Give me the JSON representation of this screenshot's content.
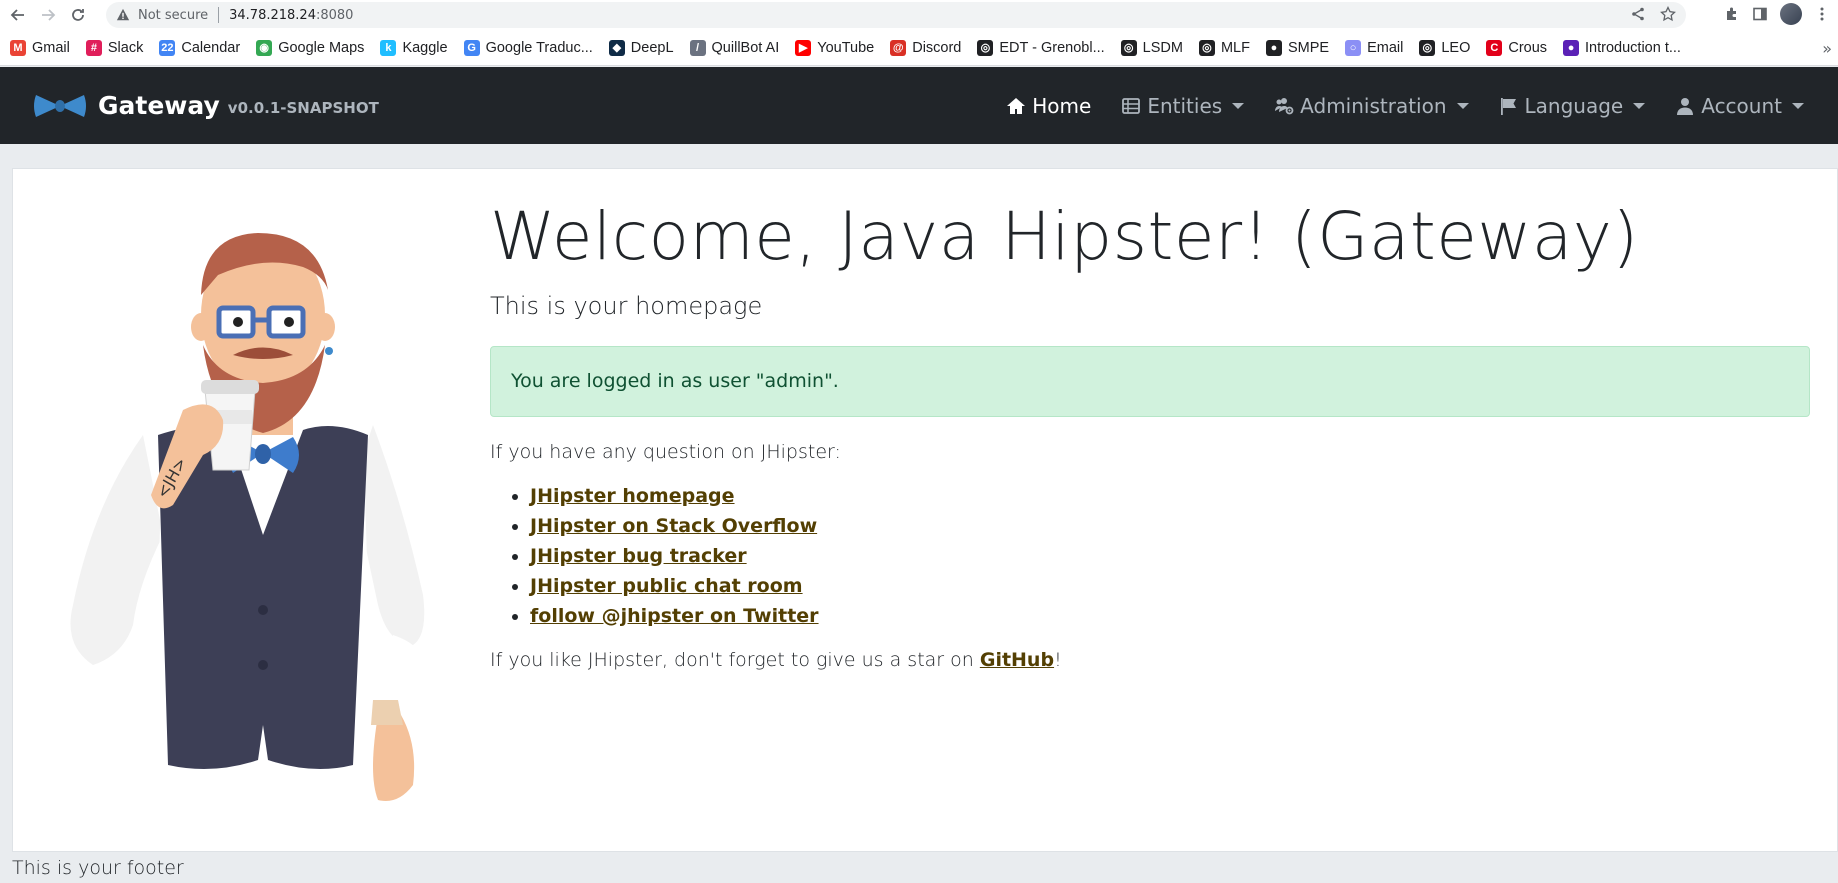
{
  "browser": {
    "security_label": "Not secure",
    "url_host": "34.78.218.24",
    "url_port": ":8080"
  },
  "bookmarks": [
    {
      "label": "Gmail",
      "icon": "gmail-icon",
      "color": "#ea4335",
      "glyph": "M"
    },
    {
      "label": "Slack",
      "icon": "slack-icon",
      "color": "#e01e5a",
      "glyph": "#"
    },
    {
      "label": "Calendar",
      "icon": "calendar-icon",
      "color": "#4285f4",
      "glyph": "22"
    },
    {
      "label": "Google Maps",
      "icon": "maps-icon",
      "color": "#34a853",
      "glyph": "◉"
    },
    {
      "label": "Kaggle",
      "icon": "kaggle-icon",
      "color": "#20beff",
      "glyph": "k"
    },
    {
      "label": "Google Traduc...",
      "icon": "translate-icon",
      "color": "#4285f4",
      "glyph": "G"
    },
    {
      "label": "DeepL",
      "icon": "deepl-icon",
      "color": "#0f2b46",
      "glyph": "◆"
    },
    {
      "label": "QuillBot AI",
      "icon": "quillbot-icon",
      "color": "#6b7280",
      "glyph": "/"
    },
    {
      "label": "YouTube",
      "icon": "youtube-icon",
      "color": "#ff0000",
      "glyph": "▶"
    },
    {
      "label": "Discord",
      "icon": "discord-icon",
      "color": "#d93025",
      "glyph": "@"
    },
    {
      "label": "EDT - Grenobl...",
      "icon": "globe-icon",
      "color": "#202124",
      "glyph": "◎"
    },
    {
      "label": "LSDM",
      "icon": "globe-icon",
      "color": "#202124",
      "glyph": "◎"
    },
    {
      "label": "MLF",
      "icon": "globe-icon",
      "color": "#202124",
      "glyph": "◎"
    },
    {
      "label": "SMPE",
      "icon": "github-icon",
      "color": "#202124",
      "glyph": "●"
    },
    {
      "label": "Email",
      "icon": "email-icon",
      "color": "#8b8ff5",
      "glyph": "○"
    },
    {
      "label": "LEO",
      "icon": "globe-icon",
      "color": "#202124",
      "glyph": "◎"
    },
    {
      "label": "Crous",
      "icon": "crous-icon",
      "color": "#e2001a",
      "glyph": "C"
    },
    {
      "label": "Introduction t...",
      "icon": "intro-icon",
      "color": "#5b21b6",
      "glyph": "●"
    }
  ],
  "navbar": {
    "brand_name": "Gateway",
    "brand_version": "v0.0.1-SNAPSHOT",
    "items": [
      {
        "label": "Home",
        "icon": "home-icon",
        "active": true
      },
      {
        "label": "Entities",
        "icon": "table-icon",
        "dropdown": true
      },
      {
        "label": "Administration",
        "icon": "users-cog-icon",
        "dropdown": true
      },
      {
        "label": "Language",
        "icon": "flag-icon",
        "dropdown": true
      },
      {
        "label": "Account",
        "icon": "user-icon",
        "dropdown": true
      }
    ]
  },
  "main": {
    "title": "Welcome, Java Hipster! (Gateway)",
    "subtitle": "This is your homepage",
    "alert": "You are logged in as user \"admin\".",
    "question": "If you have any question on JHipster:",
    "links": [
      "JHipster homepage",
      "JHipster on Stack Overflow",
      "JHipster bug tracker",
      "JHipster public chat room",
      "follow @jhipster on Twitter"
    ],
    "star_prefix": "If you like JHipster, don't forget to give us a star on ",
    "star_link": "GitHub",
    "star_suffix": "!",
    "hipster_tattoo": "<JH>"
  },
  "footer": {
    "text": "This is your footer"
  },
  "colors": {
    "navbar_bg": "#212529",
    "alert_bg": "#d1f2dd",
    "alert_text": "#0f5132",
    "link": "#533f03",
    "brand_blue": "#3e8acc"
  }
}
